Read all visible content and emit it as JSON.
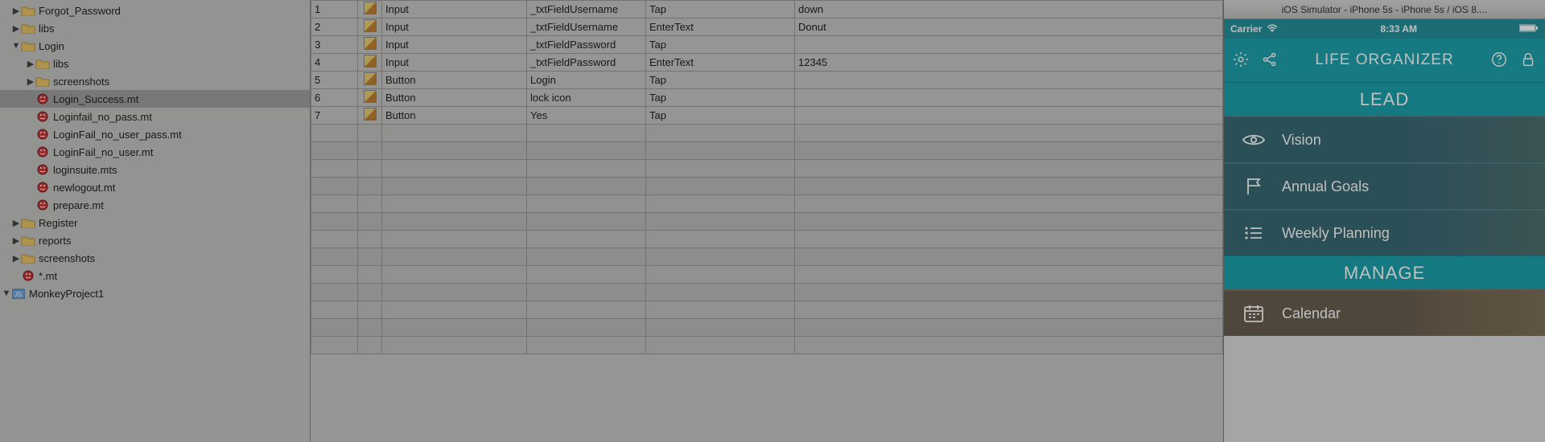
{
  "tree": {
    "items": [
      {
        "depth": 0,
        "arrow": "▶",
        "iconType": "folder",
        "label": "Forgot_Password"
      },
      {
        "depth": 0,
        "arrow": "▶",
        "iconType": "folder",
        "label": "libs"
      },
      {
        "depth": 0,
        "arrow": "▼",
        "iconType": "folder",
        "label": "Login"
      },
      {
        "depth": 1,
        "arrow": "▶",
        "iconType": "folder",
        "label": "libs"
      },
      {
        "depth": 1,
        "arrow": "▶",
        "iconType": "folder",
        "label": "screenshots"
      },
      {
        "depth": 1,
        "arrow": "",
        "iconType": "mt",
        "label": "Login_Success.mt",
        "selected": true
      },
      {
        "depth": 1,
        "arrow": "",
        "iconType": "mt",
        "label": "Loginfail_no_pass.mt"
      },
      {
        "depth": 1,
        "arrow": "",
        "iconType": "mt",
        "label": "LoginFail_no_user_pass.mt"
      },
      {
        "depth": 1,
        "arrow": "",
        "iconType": "mt",
        "label": "LoginFail_no_user.mt"
      },
      {
        "depth": 1,
        "arrow": "",
        "iconType": "mt",
        "label": "loginsuite.mts"
      },
      {
        "depth": 1,
        "arrow": "",
        "iconType": "mt",
        "label": "newlogout.mt"
      },
      {
        "depth": 1,
        "arrow": "",
        "iconType": "mt",
        "label": "prepare.mt"
      },
      {
        "depth": 0,
        "arrow": "▶",
        "iconType": "folder",
        "label": "Register"
      },
      {
        "depth": 0,
        "arrow": "▶",
        "iconType": "folder",
        "label": "reports"
      },
      {
        "depth": 0,
        "arrow": "▶",
        "iconType": "folder",
        "label": "screenshots"
      },
      {
        "depth": 0,
        "arrow": "",
        "iconType": "mt",
        "label": "*.mt"
      }
    ],
    "project": {
      "label": "MonkeyProject1"
    }
  },
  "steps": [
    {
      "num": "1",
      "type": "Input",
      "element": "_txtFieldUsername",
      "action": "Tap",
      "value": "down"
    },
    {
      "num": "2",
      "type": "Input",
      "element": "_txtFieldUsername",
      "action": "EnterText",
      "value": "Donut"
    },
    {
      "num": "3",
      "type": "Input",
      "element": "_txtFieldPassword",
      "action": "Tap",
      "value": ""
    },
    {
      "num": "4",
      "type": "Input",
      "element": "_txtFieldPassword",
      "action": "EnterText",
      "value": "12345"
    },
    {
      "num": "5",
      "type": "Button",
      "element": "Login",
      "action": "Tap",
      "value": ""
    },
    {
      "num": "6",
      "type": "Button",
      "element": "lock icon",
      "action": "Tap",
      "value": ""
    },
    {
      "num": "7",
      "type": "Button",
      "element": "Yes",
      "action": "Tap",
      "value": ""
    }
  ],
  "simulator": {
    "windowTitle": "iOS Simulator - iPhone 5s - iPhone 5s / iOS 8....",
    "status": {
      "carrier": "Carrier",
      "time": "8:33 AM"
    },
    "appTitle": "LIFE ORGANIZER",
    "sections": [
      {
        "header": "LEAD",
        "items": [
          {
            "icon": "eye",
            "label": "Vision"
          },
          {
            "icon": "flag",
            "label": "Annual Goals"
          },
          {
            "icon": "list",
            "label": "Weekly Planning"
          }
        ]
      },
      {
        "header": "MANAGE",
        "items": [
          {
            "icon": "calendar",
            "label": "Calendar",
            "variant": "calendar"
          }
        ]
      }
    ]
  }
}
